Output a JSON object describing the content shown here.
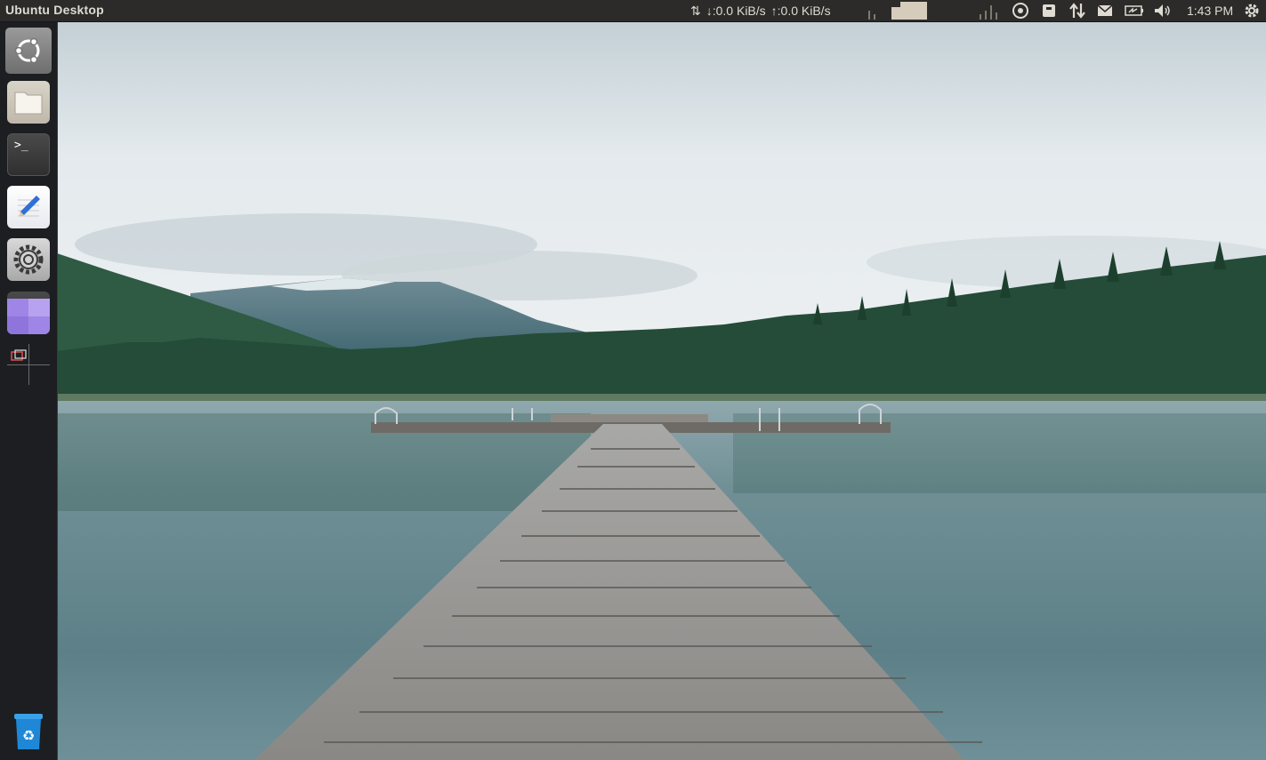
{
  "top_panel": {
    "title": "Ubuntu Desktop",
    "net_down": "↓:0.0 KiB/s",
    "net_up": "↑:0.0 KiB/s",
    "clock": "1:43 PM",
    "tray_icons": [
      "network-arrows-icon",
      "system-load-graph",
      "ubuntu-one-icon",
      "keyboard-layout-icon",
      "network-icon",
      "mail-icon",
      "battery-icon",
      "volume-icon",
      "gear-icon"
    ]
  },
  "launcher": {
    "items": [
      {
        "name": "dash",
        "icon": "ubuntu-logo-icon"
      },
      {
        "name": "files",
        "icon": "folder-icon"
      },
      {
        "name": "terminal",
        "icon": "terminal-icon",
        "glyph": ">_"
      },
      {
        "name": "text-editor",
        "icon": "pencil-icon"
      },
      {
        "name": "system-settings",
        "icon": "gear-icon"
      },
      {
        "name": "workspace-switcher",
        "icon": "workspaces-icon"
      },
      {
        "name": "trash",
        "icon": "recycle-icon"
      }
    ]
  },
  "colors": {
    "panel_bg": "#2d2b29",
    "panel_text": "#dfdbd2",
    "launcher_bg": "#1c1e22",
    "workspace_purple": "#9f86e6",
    "trash_blue": "#1e88d6"
  }
}
